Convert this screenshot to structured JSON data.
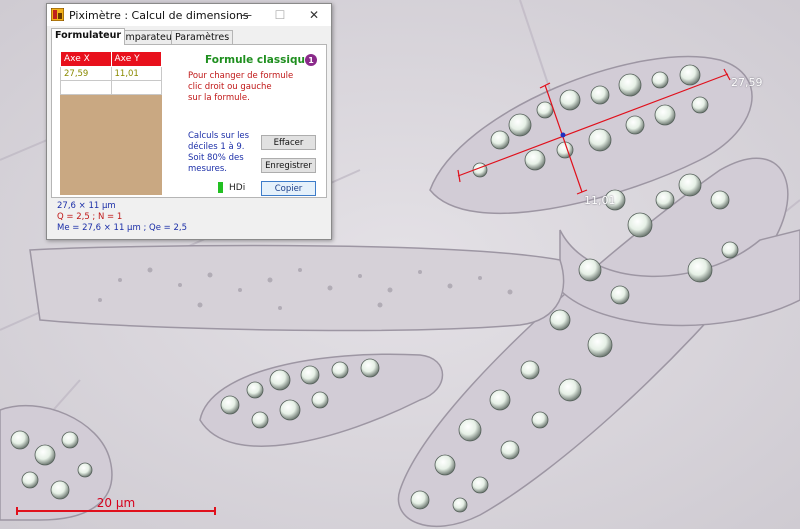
{
  "window": {
    "title": "Piximètre : Calcul de dimensions",
    "minimize_glyph": "—",
    "maximize_glyph": "☐",
    "close_glyph": "✕"
  },
  "tabs": [
    {
      "label": "Formulateur",
      "active": true
    },
    {
      "label": "Comparateur",
      "active": false
    },
    {
      "label": "Paramètres",
      "active": false
    }
  ],
  "grid": {
    "headers": [
      "Axe X",
      "Axe Y"
    ],
    "rows": [
      [
        "27,59",
        "11,01"
      ],
      [
        "",
        ""
      ]
    ]
  },
  "formula": {
    "title": "Formule classique",
    "info_badge": "1",
    "change_hint": "Pour changer de formule\nclic droit ou gauche\nsur la formule.",
    "calc_info": "Calculs sur les\ndéciles 1 à 9.\nSoit 80% des\nmesures."
  },
  "buttons": {
    "effacer": "Effacer",
    "enregistrer": "Enregistrer",
    "copier": "Copier"
  },
  "hdi_label": "HDi",
  "results": {
    "dimension": "27,6 × 11 µm",
    "q_n": "Q = 2,5 ; N = 1",
    "me_qe": "Me = 27,6 × 11 µm ; Qe = 2,5"
  },
  "measurements": {
    "length_label": "27,59",
    "width_label": "11,01"
  },
  "scale_bar": {
    "label": "20 µm"
  },
  "colors": {
    "accent_red": "#e8101c",
    "grid_bg": "#c9a882",
    "formula_green": "#1f8f1f",
    "text_blue": "#1c2fa8",
    "text_red": "#c01818"
  }
}
